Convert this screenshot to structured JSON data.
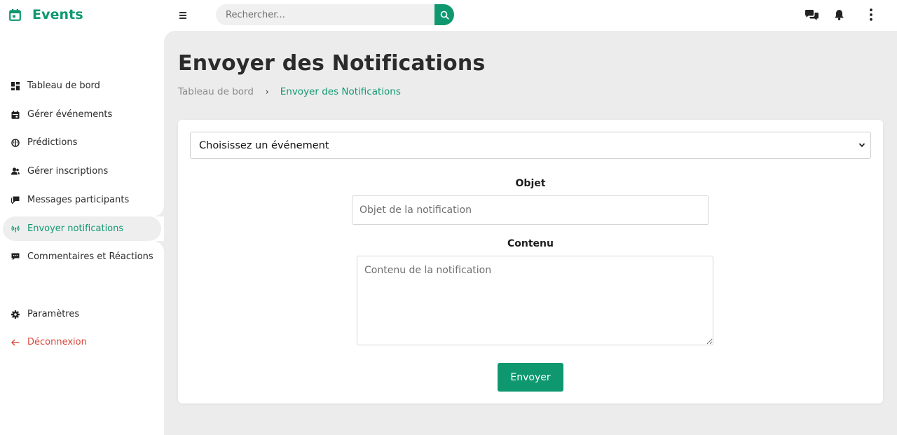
{
  "app": {
    "name": "Events",
    "brand_icon": "calendar-icon"
  },
  "colors": {
    "accent": "#0f9870",
    "danger": "#d9463a",
    "main_bg": "#ececec"
  },
  "header": {
    "search_placeholder": "Rechercher...",
    "icons": [
      "menu-icon",
      "search-icon",
      "chat-icon",
      "bell-icon",
      "more-vertical-icon"
    ]
  },
  "sidebar": {
    "items": [
      {
        "label": "Tableau de bord",
        "icon": "dashboard-icon"
      },
      {
        "label": "Gérer événements",
        "icon": "calendar-icon"
      },
      {
        "label": "Prédictions",
        "icon": "brain-icon"
      },
      {
        "label": "Gérer inscriptions",
        "icon": "users-icon"
      },
      {
        "label": "Messages participants",
        "icon": "message-icon"
      },
      {
        "label": "Envoyer notifications",
        "icon": "broadcast-icon",
        "active": true
      },
      {
        "label": "Commentaires et Réactions",
        "icon": "comment-icon"
      }
    ],
    "settings": {
      "label": "Paramètres",
      "icon": "gear-icon"
    },
    "logout": {
      "label": "Déconnexion",
      "icon": "arrow-left-icon"
    }
  },
  "page": {
    "title": "Envoyer des Notifications",
    "breadcrumb": {
      "home": "Tableau de bord",
      "separator": "›",
      "current": "Envoyer des Notifications"
    }
  },
  "form": {
    "event_select": {
      "selected": "Choisissez un événement"
    },
    "objet": {
      "label": "Objet",
      "placeholder": "Objet de la notification"
    },
    "contenu": {
      "label": "Contenu",
      "placeholder": "Contenu de la notification"
    },
    "submit_label": "Envoyer"
  }
}
